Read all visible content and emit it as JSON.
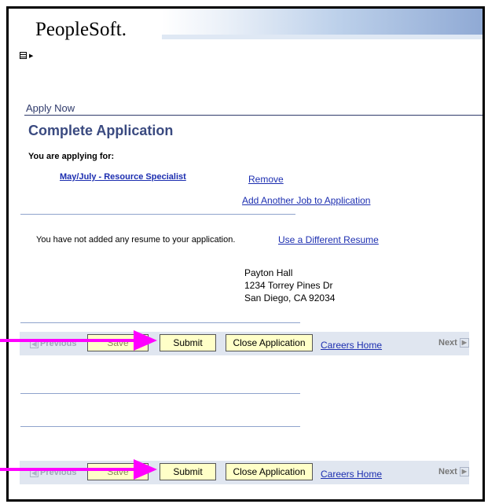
{
  "header": {
    "logo_text": "PeopleSoft.",
    "menu_icon": "menu-list-icon"
  },
  "page": {
    "section": "Apply Now",
    "title": "Complete Application",
    "applying_label": "You are applying for:",
    "job_title": "May/July - Resource Specialist",
    "remove_link": "Remove",
    "add_job_link": "Add Another Job to Application",
    "resume_message": "You have not added any resume to your application.",
    "different_resume_link": "Use a Different Resume",
    "address": [
      "Payton Hall",
      "1234 Torrey Pines Dr",
      "San Diego, CA 92034"
    ]
  },
  "toolbar": {
    "previous_label": "Previous",
    "save_label": "Save",
    "submit_label": "Submit",
    "close_label": "Close Application",
    "careers_home_label": "Careers Home",
    "next_label": "Next"
  },
  "colors": {
    "annotation_arrow": "#ff00ff",
    "button_fill": "#ffffc8",
    "link": "#1c2eb0",
    "toolbar_bg": "#e0e6f0"
  }
}
